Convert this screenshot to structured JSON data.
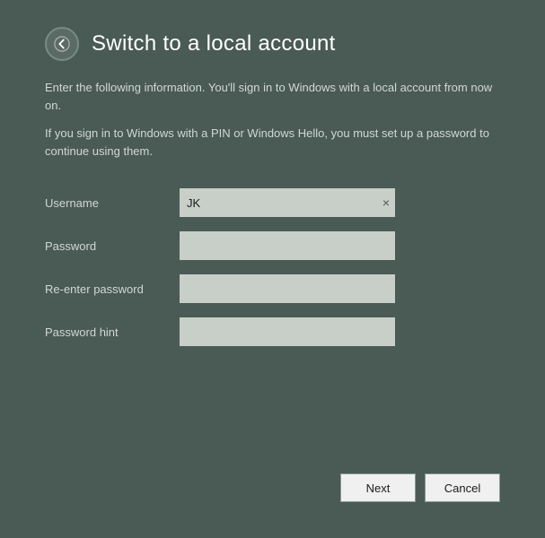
{
  "header": {
    "back_icon": "back-arrow",
    "title": "Switch to a local account"
  },
  "descriptions": {
    "line1": "Enter the following information. You'll sign in to Windows with a local account from now on.",
    "line2": "If you sign in to Windows with a PIN or Windows Hello, you must set up a password to continue using them."
  },
  "form": {
    "username_label": "Username",
    "username_value": "JK",
    "username_placeholder": "",
    "password_label": "Password",
    "password_value": "",
    "password_placeholder": "",
    "reenter_label": "Re-enter password",
    "reenter_value": "",
    "reenter_placeholder": "",
    "hint_label": "Password hint",
    "hint_value": "",
    "hint_placeholder": "",
    "clear_icon": "×"
  },
  "footer": {
    "next_label": "Next",
    "cancel_label": "Cancel"
  }
}
